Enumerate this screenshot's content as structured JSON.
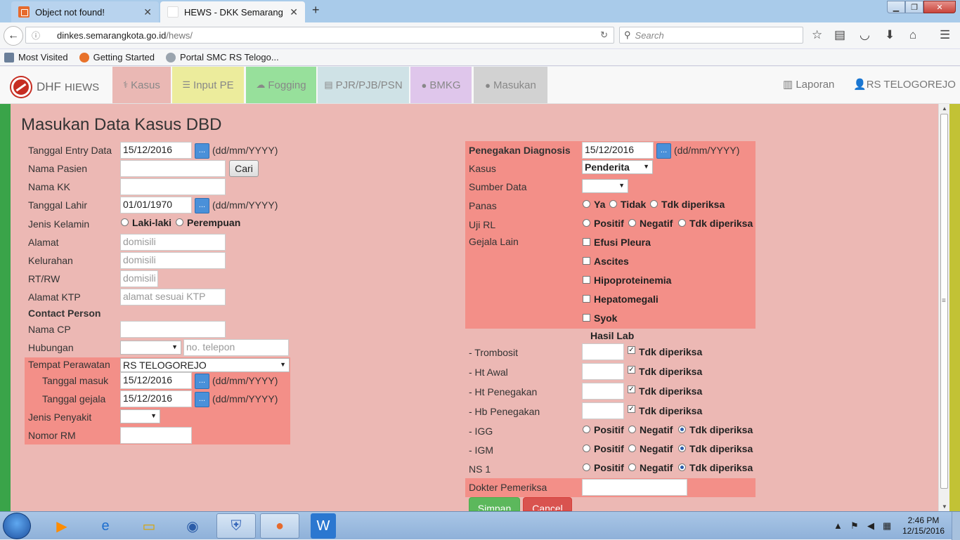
{
  "browser": {
    "tabs": [
      {
        "label": "Object not found!",
        "active": false
      },
      {
        "label": "HEWS - DKK Semarang",
        "active": true
      }
    ],
    "url_host": "dinkes.semarangkota.go.id",
    "url_path": "/hews/",
    "search_placeholder": "Search",
    "bookmarks": [
      "Most Visited",
      "Getting Started",
      "Portal SMC RS Telogo..."
    ]
  },
  "app": {
    "brand_dhf": "DHF",
    "brand_hiews": "HIEWS",
    "menu": [
      {
        "icon": "stethoscope-icon",
        "label": "Kasus"
      },
      {
        "icon": "list-icon",
        "label": "Input PE"
      },
      {
        "icon": "cloud-icon",
        "label": "Fogging"
      },
      {
        "icon": "document-icon",
        "label": "PJR/PJB/PSN"
      },
      {
        "icon": "comments-icon",
        "label": "BMKG"
      },
      {
        "icon": "comment-icon",
        "label": "Masukan"
      }
    ],
    "right_menu": {
      "report": "Laporan",
      "user": "RS TELOGOREJO"
    }
  },
  "form": {
    "title": "Masukan Data Kasus DBD",
    "date_format": "(dd/mm/YYYY)",
    "cal_label": "...",
    "left": {
      "tanggal_entry": {
        "label": "Tanggal Entry Data",
        "value": "15/12/2016"
      },
      "nama_pasien": {
        "label": "Nama Pasien",
        "value": "",
        "button": "Cari"
      },
      "nama_kk": {
        "label": "Nama KK",
        "value": ""
      },
      "tanggal_lahir": {
        "label": "Tanggal Lahir",
        "value": "01/01/1970"
      },
      "jenis_kelamin": {
        "label": "Jenis Kelamin",
        "options": [
          "Laki-laki",
          "Perempuan"
        ]
      },
      "alamat": {
        "label": "Alamat",
        "placeholder": "domisili"
      },
      "kelurahan": {
        "label": "Kelurahan",
        "placeholder": "domisili"
      },
      "rtrw": {
        "label": "RT/RW",
        "placeholder": "domisili"
      },
      "alamat_ktp": {
        "label": "Alamat KTP",
        "placeholder": "alamat sesuai KTP"
      },
      "contact_person": "Contact Person",
      "nama_cp": {
        "label": "Nama CP",
        "value": ""
      },
      "hubungan": {
        "label": "Hubungan",
        "phone_placeholder": "no. telepon"
      },
      "tempat_perawatan": {
        "label": "Tempat Perawatan",
        "value": "RS TELOGOREJO"
      },
      "tanggal_masuk": {
        "label": "Tanggal masuk",
        "value": "15/12/2016"
      },
      "tanggal_gejala": {
        "label": "Tanggal gejala",
        "value": "15/12/2016"
      },
      "jenis_penyakit": {
        "label": "Jenis Penyakit",
        "value": ""
      },
      "nomor_rm": {
        "label": "Nomor RM",
        "value": ""
      }
    },
    "right": {
      "penegakan": {
        "label": "Penegakan Diagnosis",
        "value": "15/12/2016"
      },
      "kasus": {
        "label": "Kasus",
        "value": "Penderita"
      },
      "sumber_data": {
        "label": "Sumber Data",
        "value": ""
      },
      "panas": {
        "label": "Panas",
        "options": [
          "Ya",
          "Tidak",
          "Tdk diperiksa"
        ]
      },
      "uji_rl": {
        "label": "Uji RL",
        "options": [
          "Positif",
          "Negatif",
          "Tdk diperiksa"
        ]
      },
      "gejala_lain": {
        "label": "Gejala Lain",
        "options": [
          "Efusi Pleura",
          "Ascites",
          "Hipoproteinemia",
          "Hepatomegali",
          "Syok"
        ]
      },
      "hasil_lab": "Hasil Lab",
      "lab_inputs": [
        {
          "label": "- Trombosit",
          "check": "Tdk diperiksa"
        },
        {
          "label": "- Ht Awal",
          "check": "Tdk diperiksa"
        },
        {
          "label": "- Ht Penegakan",
          "check": "Tdk diperiksa"
        },
        {
          "label": "- Hb Penegakan",
          "check": "Tdk diperiksa"
        }
      ],
      "lab_radios": [
        {
          "label": "- IGG",
          "options": [
            "Positif",
            "Negatif",
            "Tdk diperiksa"
          ]
        },
        {
          "label": "- IGM",
          "options": [
            "Positif",
            "Negatif",
            "Tdk diperiksa"
          ]
        },
        {
          "label": "NS 1",
          "options": [
            "Positif",
            "Negatif",
            "Tdk diperiksa"
          ]
        }
      ],
      "dokter": {
        "label": "Dokter Pemeriksa",
        "value": ""
      }
    },
    "buttons": {
      "save": "Simpan",
      "cancel": "Cancel"
    }
  },
  "taskbar": {
    "time": "2:46 PM",
    "date": "12/15/2016"
  },
  "colors": {
    "kasus": "#eab8b4",
    "input_pe": "#ecec9c",
    "fogging": "#97e09b",
    "pjr": "#cfe2e6",
    "bmkg": "#dfc6eb",
    "masukan": "#d2d2d2",
    "panel": "#f38f88",
    "save": "#5cb85c",
    "cancel": "#d9534f"
  }
}
